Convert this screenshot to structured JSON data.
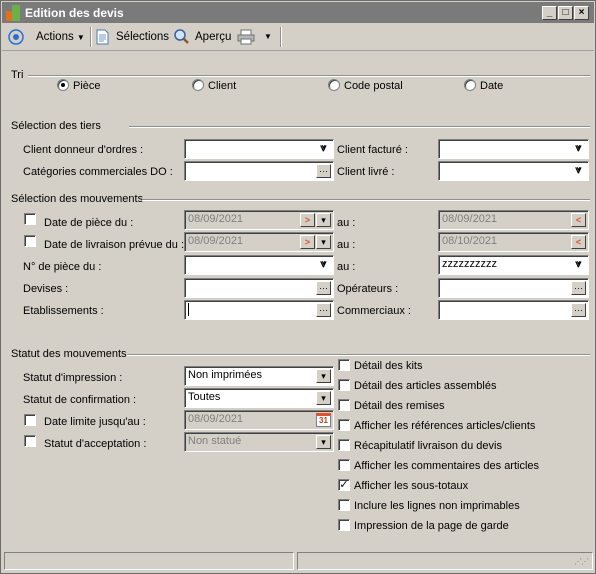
{
  "window": {
    "title": "Edition des devis"
  },
  "toolbar": {
    "actions": "Actions",
    "selections": "Sélections",
    "apercu": "Aperçu"
  },
  "tri": {
    "title": "Tri",
    "options": [
      "Pièce",
      "Client",
      "Code postal",
      "Date"
    ],
    "selected": "Pièce"
  },
  "tiers": {
    "title": "Sélection des tiers",
    "client_donneur": "Client donneur d'ordres :",
    "categories": "Catégories commerciales DO :",
    "client_facture": "Client facturé :",
    "client_livre": "Client livré :"
  },
  "mouvements": {
    "title": "Sélection des mouvements",
    "date_piece": "Date de pièce du :",
    "date_piece_from": "08/09/2021",
    "date_piece_to": "08/09/2021",
    "date_livraison": "Date de livraison prévue du :",
    "date_livraison_from": "08/09/2021",
    "date_livraison_to": "08/10/2021",
    "num_piece": "N° de pièce du :",
    "num_piece_to": "zzzzzzzzzz",
    "au": "au :",
    "devises": "Devises :",
    "operateurs": "Opérateurs :",
    "etablissements": "Etablissements :",
    "commerciaux": "Commerciaux :"
  },
  "statut": {
    "title": "Statut des mouvements",
    "impression_label": "Statut d'impression :",
    "impression_value": "Non imprimées",
    "confirmation_label": "Statut de confirmation :",
    "confirmation_value": "Toutes",
    "date_limite_label": "Date limite jusqu'au :",
    "date_limite_value": "08/09/2021",
    "acceptation_label": "Statut d'acceptation :",
    "acceptation_value": "Non statué"
  },
  "options": [
    {
      "label": "Détail des kits",
      "checked": false
    },
    {
      "label": "Détail des articles assemblés",
      "checked": false
    },
    {
      "label": "Détail des remises",
      "checked": false
    },
    {
      "label": "Afficher les références articles/clients",
      "checked": false
    },
    {
      "label": "Récapitulatif livraison du devis",
      "checked": false
    },
    {
      "label": "Afficher les commentaires des articles",
      "checked": false
    },
    {
      "label": "Afficher les sous-totaux",
      "checked": true
    },
    {
      "label": "Inclure les lignes non imprimables",
      "checked": false
    },
    {
      "label": "Impression de la page de garde",
      "checked": false
    }
  ],
  "calendar_day": "31",
  "colors": {
    "titlebar": "#7a7a7a",
    "window_bg": "#d4d0c8",
    "accent_orange": "#e0522a"
  }
}
